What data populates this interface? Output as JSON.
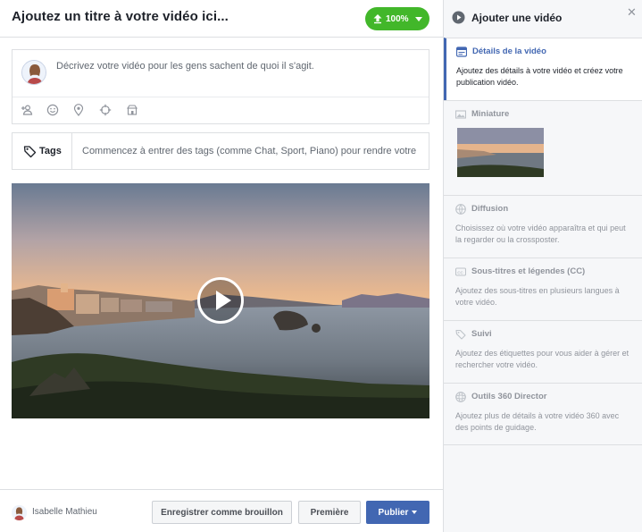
{
  "composer": {
    "title_placeholder": "Ajoutez un titre à votre vidéo ici...",
    "upload_progress": "100%",
    "description_placeholder": "Décrivez votre vidéo pour les gens sachent de quoi il s'agit.",
    "tags_label": "Tags",
    "tags_placeholder": "Commencez à entrer des tags (comme Chat, Sport, Piano) pour rendre votre"
  },
  "footer": {
    "author": "Isabelle Mathieu",
    "draft_label": "Enregistrer comme brouillon",
    "premiere_label": "Première",
    "publish_label": "Publier"
  },
  "sidebar": {
    "title": "Ajouter une vidéo",
    "steps": [
      {
        "title": "Détails de la vidéo",
        "desc": "Ajoutez des détails à votre vidéo et créez votre publication vidéo.",
        "icon": "details-icon"
      },
      {
        "title": "Miniature",
        "desc": "",
        "icon": "thumbnail-icon"
      },
      {
        "title": "Diffusion",
        "desc": "Choisissez où votre vidéo apparaîtra et qui peut la regarder ou la crossposter.",
        "icon": "globe-icon"
      },
      {
        "title": "Sous-titres et légendes (CC)",
        "desc": "Ajoutez des sous-titres en plusieurs langues à votre vidéo.",
        "icon": "cc-icon"
      },
      {
        "title": "Suivi",
        "desc": "Ajoutez des étiquettes pour vous aider à gérer et rechercher votre vidéo.",
        "icon": "tag-icon"
      },
      {
        "title": "Outils 360 Director",
        "desc": "Ajoutez plus de détails à votre vidéo 360 avec des points de guidage.",
        "icon": "360-icon"
      }
    ]
  },
  "colors": {
    "brand_blue": "#4267b2",
    "upload_green": "#42b72a",
    "muted_text": "#90949c"
  }
}
